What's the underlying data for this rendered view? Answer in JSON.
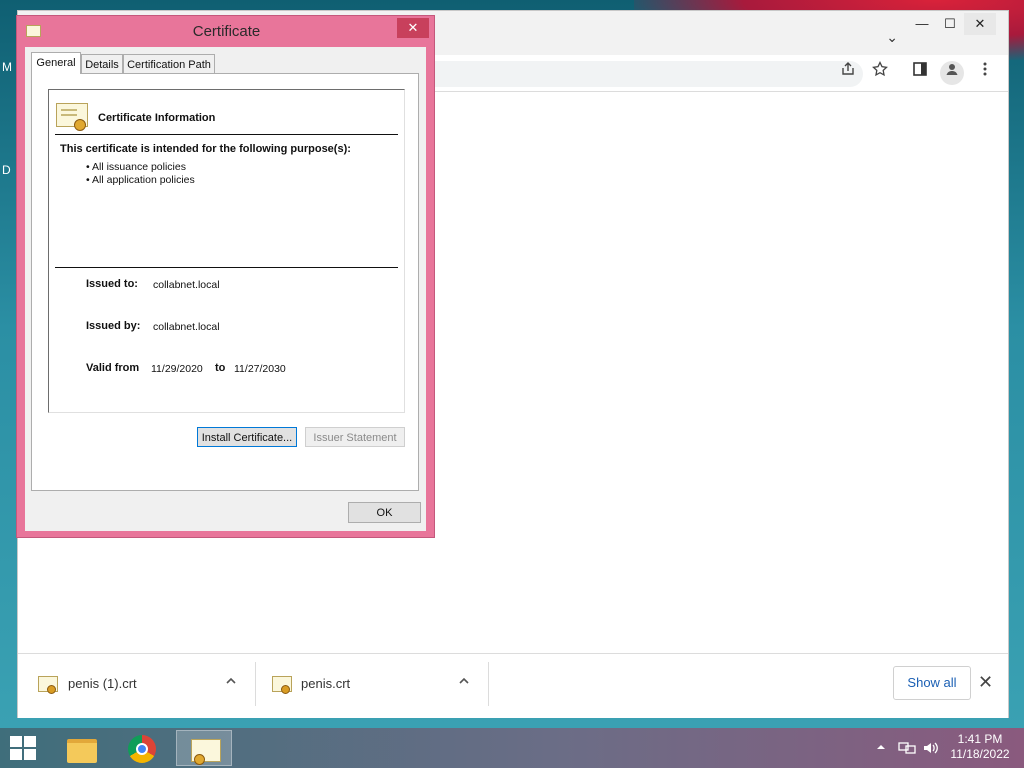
{
  "dialog": {
    "title": "Certificate",
    "close_glyph": "✕",
    "tabs": [
      "General",
      "Details",
      "Certification Path"
    ],
    "info_title": "Certificate Information",
    "purpose_heading": "This certificate is intended for the following purpose(s):",
    "purposes": [
      "• All issuance policies",
      "• All application policies"
    ],
    "issued_to_label": "Issued to:",
    "issued_to_value": "collabnet.local",
    "issued_by_label": "Issued by:",
    "issued_by_value": "collabnet.local",
    "valid_from_label": "Valid from",
    "valid_from_value": "11/29/2020",
    "valid_to_label": "to",
    "valid_to_value": "11/27/2030",
    "install_button": "Install Certificate...",
    "issuer_statement_button": "Issuer Statement",
    "ok_button": "OK"
  },
  "browser": {
    "minimize_glyph": "—",
    "maximize_glyph": "☐",
    "close_glyph": "✕",
    "tab_search_glyph": "⌄",
    "toolbar_icons": [
      "share-icon",
      "star-icon",
      "side-panel-icon",
      "profile-icon",
      "menu-icon"
    ]
  },
  "downloads": {
    "items": [
      {
        "name": "penis (1).crt",
        "icon": "certificate-file-icon"
      },
      {
        "name": "penis.crt",
        "icon": "certificate-file-icon"
      }
    ],
    "show_all": "Show all",
    "close_glyph": "✕"
  },
  "desktop": {
    "edge_letters": [
      "M",
      "D"
    ]
  },
  "taskbar": {
    "apps": [
      "file-explorer-icon",
      "chrome-icon",
      "certificate-icon"
    ],
    "clock_time": "1:41 PM",
    "clock_date": "11/18/2022"
  },
  "colors": {
    "dialog_frame": "#e8759a",
    "dialog_close": "#c8405c",
    "link_blue": "#1a5fb4"
  }
}
